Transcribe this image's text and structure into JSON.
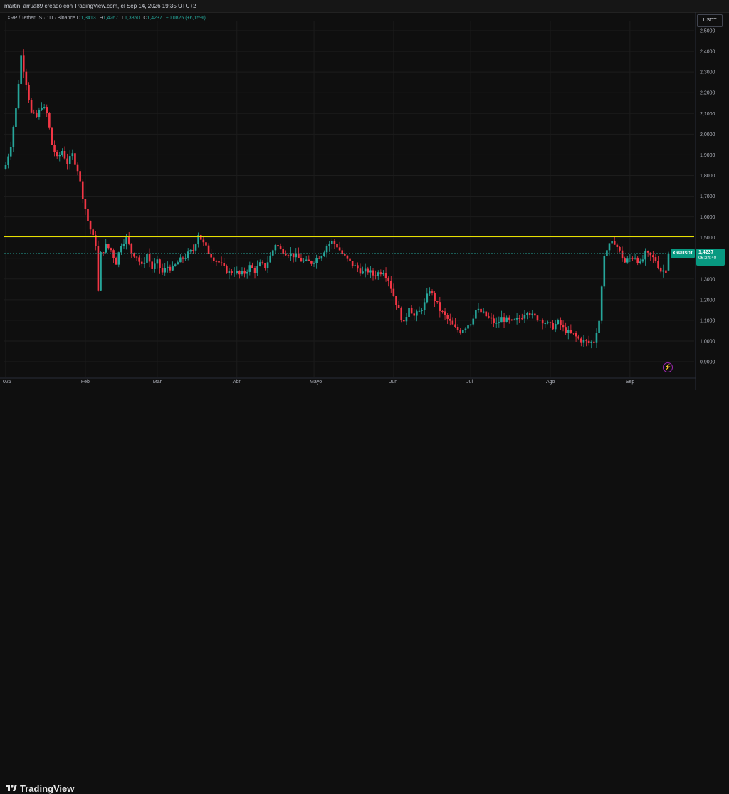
{
  "header": {
    "text": "martin_arrua89 creado con TradingView.com, el Sep 14, 2026 19:35 UTC+2"
  },
  "legend": {
    "symbol": "XRP / TetherUS · 1D · Binance",
    "open_label": "O",
    "open": "1,3413",
    "high_label": "H",
    "high": "1,4267",
    "low_label": "L",
    "low": "1,3350",
    "close_label": "C",
    "close": "1,4237",
    "change": "+0,0825 (+6,15%)"
  },
  "currency_button": "USDT",
  "price_badge": {
    "symbol": "XRPUSDT",
    "price": "1,4237",
    "countdown": "06:24:40"
  },
  "footer": {
    "brand": "TradingView"
  },
  "colors": {
    "up": "#26a69a",
    "down": "#f23645",
    "level": "#e8e000",
    "background": "#0f0f0f",
    "grid": "#1e1e1e"
  },
  "icons": {
    "alert": "lightning-icon",
    "logo": "tradingview-logo-icon"
  },
  "chart_data": {
    "type": "candlestick",
    "ylim": [
      0.88,
      2.53
    ],
    "y_ticks": [
      "2,5000",
      "2,4000",
      "2,3000",
      "2,2000",
      "2,1000",
      "2,0000",
      "1,9000",
      "1,8000",
      "1,7000",
      "1,6000",
      "1,5000",
      "1,4000",
      "1,3000",
      "1,2000",
      "1,1000",
      "1,0000",
      "0,9000"
    ],
    "y_tick_values": [
      2.5,
      2.4,
      2.3,
      2.2,
      2.1,
      2.0,
      1.9,
      1.8,
      1.7,
      1.6,
      1.5,
      1.4,
      1.3,
      1.2,
      1.1,
      1.0,
      0.9
    ],
    "x_ticks": [
      {
        "label": "026",
        "day": 0
      },
      {
        "label": "Feb",
        "day": 31
      },
      {
        "label": "Mar",
        "day": 59
      },
      {
        "label": "Abr",
        "day": 90
      },
      {
        "label": "Mayo",
        "day": 120
      },
      {
        "label": "Jun",
        "day": 151
      },
      {
        "label": "Jul",
        "day": 181
      },
      {
        "label": "Ago",
        "day": 212
      },
      {
        "label": "Sep",
        "day": 243
      }
    ],
    "horizontal_level": 1.505,
    "last_close": 1.4237,
    "close_path": [
      [
        0,
        1.85
      ],
      [
        2,
        1.95
      ],
      [
        4,
        2.12
      ],
      [
        6,
        2.38
      ],
      [
        8,
        2.25
      ],
      [
        10,
        2.1
      ],
      [
        12,
        2.08
      ],
      [
        14,
        2.14
      ],
      [
        16,
        2.1
      ],
      [
        18,
        1.95
      ],
      [
        20,
        1.88
      ],
      [
        22,
        1.92
      ],
      [
        24,
        1.86
      ],
      [
        26,
        1.9
      ],
      [
        28,
        1.83
      ],
      [
        30,
        1.7
      ],
      [
        32,
        1.58
      ],
      [
        34,
        1.5
      ],
      [
        35,
        1.47
      ],
      [
        36,
        1.24
      ],
      [
        37,
        1.42
      ],
      [
        39,
        1.46
      ],
      [
        41,
        1.44
      ],
      [
        43,
        1.38
      ],
      [
        45,
        1.47
      ],
      [
        47,
        1.5
      ],
      [
        49,
        1.43
      ],
      [
        51,
        1.41
      ],
      [
        53,
        1.36
      ],
      [
        55,
        1.42
      ],
      [
        57,
        1.35
      ],
      [
        59,
        1.38
      ],
      [
        61,
        1.33
      ],
      [
        63,
        1.36
      ],
      [
        65,
        1.35
      ],
      [
        67,
        1.38
      ],
      [
        69,
        1.4
      ],
      [
        71,
        1.42
      ],
      [
        73,
        1.44
      ],
      [
        75,
        1.52
      ],
      [
        77,
        1.47
      ],
      [
        79,
        1.43
      ],
      [
        81,
        1.4
      ],
      [
        83,
        1.38
      ],
      [
        85,
        1.35
      ],
      [
        87,
        1.33
      ],
      [
        89,
        1.34
      ],
      [
        91,
        1.32
      ],
      [
        93,
        1.33
      ],
      [
        95,
        1.36
      ],
      [
        97,
        1.34
      ],
      [
        99,
        1.37
      ],
      [
        101,
        1.36
      ],
      [
        103,
        1.41
      ],
      [
        105,
        1.47
      ],
      [
        107,
        1.44
      ],
      [
        109,
        1.43
      ],
      [
        111,
        1.42
      ],
      [
        113,
        1.41
      ],
      [
        115,
        1.39
      ],
      [
        117,
        1.38
      ],
      [
        119,
        1.38
      ],
      [
        121,
        1.4
      ],
      [
        123,
        1.42
      ],
      [
        125,
        1.46
      ],
      [
        127,
        1.48
      ],
      [
        129,
        1.46
      ],
      [
        131,
        1.42
      ],
      [
        133,
        1.39
      ],
      [
        135,
        1.37
      ],
      [
        137,
        1.35
      ],
      [
        139,
        1.33
      ],
      [
        141,
        1.34
      ],
      [
        143,
        1.32
      ],
      [
        145,
        1.33
      ],
      [
        147,
        1.34
      ],
      [
        149,
        1.3
      ],
      [
        151,
        1.22
      ],
      [
        153,
        1.15
      ],
      [
        155,
        1.08
      ],
      [
        157,
        1.17
      ],
      [
        159,
        1.12
      ],
      [
        161,
        1.14
      ],
      [
        163,
        1.18
      ],
      [
        165,
        1.25
      ],
      [
        167,
        1.2
      ],
      [
        169,
        1.15
      ],
      [
        171,
        1.12
      ],
      [
        173,
        1.09
      ],
      [
        175,
        1.06
      ],
      [
        177,
        1.05
      ],
      [
        179,
        1.07
      ],
      [
        181,
        1.09
      ],
      [
        183,
        1.15
      ],
      [
        185,
        1.14
      ],
      [
        187,
        1.12
      ],
      [
        189,
        1.1
      ],
      [
        191,
        1.08
      ],
      [
        193,
        1.11
      ],
      [
        195,
        1.1
      ],
      [
        197,
        1.09
      ],
      [
        199,
        1.1
      ],
      [
        201,
        1.12
      ],
      [
        203,
        1.15
      ],
      [
        205,
        1.12
      ],
      [
        207,
        1.11
      ],
      [
        209,
        1.1
      ],
      [
        211,
        1.08
      ],
      [
        213,
        1.07
      ],
      [
        215,
        1.09
      ],
      [
        217,
        1.06
      ],
      [
        219,
        1.04
      ],
      [
        221,
        1.03
      ],
      [
        223,
        1.01
      ],
      [
        225,
        1.0
      ],
      [
        227,
        0.99
      ],
      [
        229,
        1.0
      ],
      [
        231,
        1.1
      ],
      [
        233,
        1.42
      ],
      [
        235,
        1.46
      ],
      [
        237,
        1.48
      ],
      [
        239,
        1.43
      ],
      [
        241,
        1.38
      ],
      [
        243,
        1.4
      ],
      [
        245,
        1.41
      ],
      [
        247,
        1.37
      ],
      [
        249,
        1.42
      ],
      [
        251,
        1.41
      ],
      [
        253,
        1.39
      ],
      [
        255,
        1.34
      ],
      [
        257,
        1.343
      ],
      [
        258,
        1.4237
      ]
    ]
  }
}
